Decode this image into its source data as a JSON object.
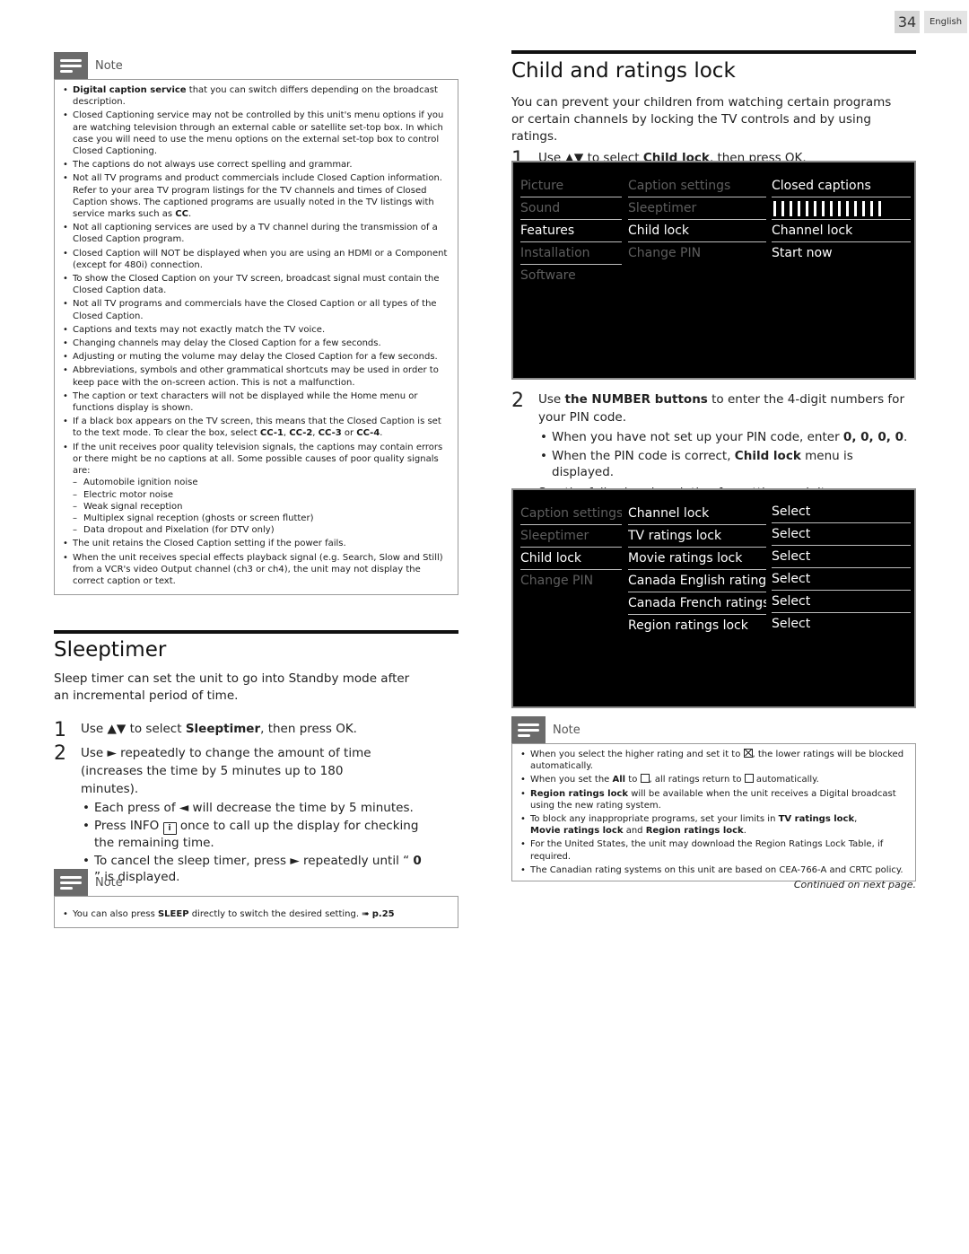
{
  "header": {
    "page_number": "34",
    "language": "English"
  },
  "left_note": {
    "title": "Note",
    "items": [
      {
        "bold": "Digital caption service",
        "text": " that you can switch differs depending on the broadcast description."
      },
      {
        "text": "Closed Captioning service may not be controlled by this unit's menu options if you are watching television through an external cable or satellite set-top box. In which case you will need to use the menu options on the external set-top box to control Closed Captioning."
      },
      {
        "text": "The captions do not always use correct spelling and grammar."
      },
      {
        "text": "Not all TV programs and product commercials include Closed Caption information. Refer to your area TV program listings for the TV channels and times of Closed Caption shows. The captioned programs are usually noted in the TV listings with service marks such as ",
        "bold_end": "CC",
        "end": "."
      },
      {
        "text": "Not all captioning services are used by a TV channel during the transmission of a Closed Caption program."
      },
      {
        "text": "Closed Caption will NOT be displayed when you are using an HDMI or a Component (except for 480i) connection."
      },
      {
        "text": "To show the Closed Caption on your TV screen, broadcast signal must contain the Closed Caption data."
      },
      {
        "text": "Not all TV programs and commercials have the Closed Caption or all types of the Closed Caption."
      },
      {
        "text": "Captions and texts may not exactly match the TV voice."
      },
      {
        "text": "Changing channels may delay the Closed Caption for a few seconds."
      },
      {
        "text": "Adjusting or muting the volume may delay the Closed Caption for a few seconds."
      },
      {
        "text": "Abbreviations, symbols and other grammatical shortcuts may be used in order to keep pace with the on-screen action. This is not a malfunction."
      },
      {
        "text": "The caption or text characters will not be displayed while the Home menu or functions display is shown."
      },
      {
        "text": "If a black box appears on the TV screen, this means that the Closed Caption is set to the text mode. To clear the box, select ",
        "codes": [
          "CC-1",
          "CC-2",
          "CC-3",
          "CC-4"
        ]
      },
      {
        "text": "If the unit receives poor quality television signals, the captions may contain errors or there might be no captions at all. Some possible causes of poor quality signals are:",
        "dashes": [
          "Automobile ignition noise",
          "Electric motor noise",
          "Weak signal reception",
          "Multiplex signal reception (ghosts or screen flutter)",
          "Data dropout and Pixelation (for DTV only)"
        ]
      },
      {
        "text": "The unit retains the Closed Caption setting if the power fails."
      },
      {
        "text": "When the unit receives special effects playback signal (e.g. Search, Slow and Still) from a VCR's video Output channel (ch3 or ch4), the unit may not display the correct caption or text."
      }
    ]
  },
  "sleeptimer": {
    "title": "Sleeptimer",
    "intro": "Sleep timer can set the unit to go into Standby mode after an incremental period of time.",
    "step1": {
      "num": "1",
      "pre": "Use ▲▼ to select ",
      "bold": "Sleeptimer",
      "post": ", then press OK."
    },
    "step2": {
      "num": "2",
      "text": "Use ► repeatedly to change the amount of time (increases the time by 5 minutes up to 180 minutes)."
    },
    "bullets": {
      "b1": "Each press of ◄ will decrease the time by 5 minutes.",
      "b2_pre": "Press INFO ",
      "b2_icon": "i",
      "b2_post": " once to call up the display for checking the remaining time.",
      "b3_pre": "To cancel the sleep timer, press ► repeatedly until “ ",
      "b3_bold": "0",
      "b3_post": " ” is displayed."
    },
    "note": {
      "title": "Note",
      "pre": "You can also press ",
      "bold": "SLEEP",
      "post": " directly to switch the desired setting. ",
      "arrow": "➠",
      "ref": "p.25"
    }
  },
  "child_lock": {
    "title": "Child and ratings lock",
    "intro": "You can prevent your children from watching certain programs or certain channels by locking the TV controls and by using ratings.",
    "step1": {
      "num": "1",
      "pre": "Use ▲▼ to select ",
      "bold": "Child lock",
      "post": ", then press OK."
    },
    "menu1": {
      "col1": [
        "Picture",
        "Sound",
        "Features",
        "Installation",
        "Software"
      ],
      "col2": [
        "Caption settings",
        "Sleeptimer",
        "Child lock",
        "Change PIN"
      ],
      "col3": [
        "Closed captions",
        "",
        "Channel lock",
        "Start now"
      ],
      "active_col1": "Features",
      "active_col2": "Child lock"
    },
    "step2": {
      "num": "2",
      "pre": "Use ",
      "bold": "the NUMBER buttons",
      "post": " to enter the 4-digit numbers for your PIN code."
    },
    "step2_bullets": {
      "b1_pre": "When you have not set up your PIN code, enter ",
      "b1_bold": "0, 0, 0, 0",
      "b1_post": ".",
      "b2_pre": "When the PIN code is correct, ",
      "b2_bold": "Child lock",
      "b2_post": " menu is displayed."
    },
    "see_following": "See the following description for setting each item.",
    "menu2": {
      "col1": [
        "Caption settings",
        "Sleeptimer",
        "Child lock",
        "Change PIN"
      ],
      "col2": [
        "Channel lock",
        "TV ratings lock",
        "Movie ratings lock",
        "Canada English ratings lo",
        "Canada French ratings lo",
        "Region ratings lock"
      ],
      "col3": [
        "Select",
        "Select",
        "Select",
        "Select",
        "Select",
        "Select"
      ],
      "active_col1": "Child lock"
    },
    "note": {
      "title": "Note",
      "n1_pre": "When you select the higher rating and set it to ",
      "n1_post": ", the lower ratings will be blocked automatically.",
      "n2_pre": "When you set the ",
      "n2_bold": "All",
      "n2_mid": " to ",
      "n2_mid2": ", all ratings return to ",
      "n2_post": " automatically.",
      "n3_bold": "Region ratings lock",
      "n3_post": " will be available when the unit receives a Digital broadcast using the new rating system.",
      "n4_pre": "To block any inappropriate programs, set your limits in ",
      "n4_b1": "TV ratings lock",
      "n4_mid": ", ",
      "n4_b2": "Movie ratings lock",
      "n4_and": " and ",
      "n4_b3": "Region ratings lock",
      "n4_post": ".",
      "n5": "For the United States, the unit may download the Region Ratings Lock Table, if required.",
      "n6": "The Canadian rating systems on this unit are based on CEA-766-A and CRTC policy."
    },
    "continued": "Continued on next page."
  }
}
